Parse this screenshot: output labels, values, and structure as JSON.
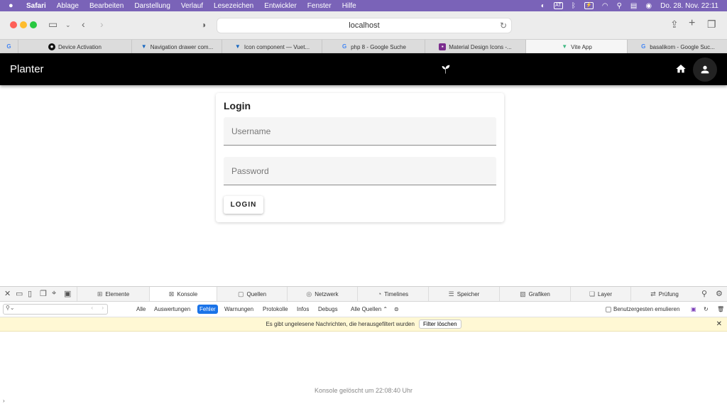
{
  "menubar": {
    "app": "Safari",
    "items": [
      "Ablage",
      "Bearbeiten",
      "Darstellung",
      "Verlauf",
      "Lesezeichen",
      "Entwickler",
      "Fenster",
      "Hilfe"
    ],
    "datetime": "Do. 28. Nov.  22:11",
    "lang_badge": "AT"
  },
  "browser": {
    "url": "localhost",
    "tabs": [
      {
        "label": "",
        "icon": "google-icon"
      },
      {
        "label": "Device Activation",
        "icon": "github-icon"
      },
      {
        "label": "Navigation drawer com...",
        "icon": "vuetify-icon"
      },
      {
        "label": "Icon component — Vuet...",
        "icon": "vuetify-icon"
      },
      {
        "label": "php 8 - Google Suche",
        "icon": "google-icon"
      },
      {
        "label": "Material Design Icons -...",
        "icon": "mdi-icon"
      },
      {
        "label": "Vite App",
        "icon": "vue-icon",
        "active": true
      },
      {
        "label": "basalikom - Google Suc...",
        "icon": "google-icon"
      }
    ]
  },
  "app": {
    "title": "Planter",
    "logo_icon": "sprout-icon",
    "accent": "#000000"
  },
  "login": {
    "title": "Login",
    "username_placeholder": "Username",
    "password_placeholder": "Password",
    "button": "LOGIN"
  },
  "devtools": {
    "tabs": [
      "Elemente",
      "Konsole",
      "Quellen",
      "Netzwerk",
      "Timelines",
      "Speicher",
      "Grafiken",
      "Layer",
      "Prüfung"
    ],
    "active_tab": "Konsole",
    "filters": [
      "Alle",
      "Auswertungen",
      "Fehler",
      "Warnungen",
      "Protokolle",
      "Infos",
      "Debugs"
    ],
    "selected_filter": "Fehler",
    "sources": "Alle Quellen",
    "emulate_label": "Benutzergesten emulieren",
    "notice": "Es gibt ungelesene Nachrichten, die herausgefiltert wurden",
    "notice_button": "Filter löschen",
    "console_message": "Konsole gelöscht um 22:08:40 Uhr"
  }
}
